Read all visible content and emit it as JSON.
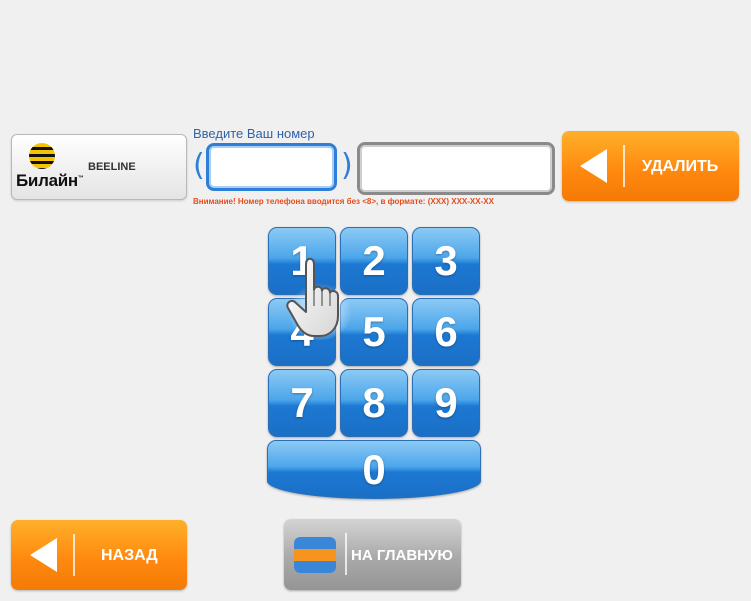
{
  "operator": {
    "logo_text": "Билайн",
    "logo_tm": "™",
    "name": "BEELINE",
    "logo_icon": "beeline-stripe-ball-icon"
  },
  "phone_input": {
    "label": "Введите Ваш номер",
    "paren_open": "(",
    "paren_close": ")",
    "code_value": "",
    "number_value": "",
    "warning": "Внимание! Номер телефона вводится без <8>, в формате: (XXX) XXX-XX-XX"
  },
  "delete_button": {
    "label": "УДАЛИТЬ",
    "icon": "back-arrow-icon"
  },
  "keypad": {
    "keys": [
      "1",
      "2",
      "3",
      "4",
      "5",
      "6",
      "7",
      "8",
      "9",
      "0"
    ]
  },
  "cursor": {
    "icon": "hand-pointer-icon"
  },
  "back_button": {
    "label": "НАЗАД",
    "icon": "back-arrow-icon"
  },
  "home_button": {
    "label": "НА ГЛАВНУЮ",
    "icon": "home-stack-icon"
  },
  "colors": {
    "accent_orange": "#ff8a10",
    "key_blue": "#1c78d2",
    "label_blue": "#2f63a8",
    "warning_red": "#e84c1a"
  }
}
